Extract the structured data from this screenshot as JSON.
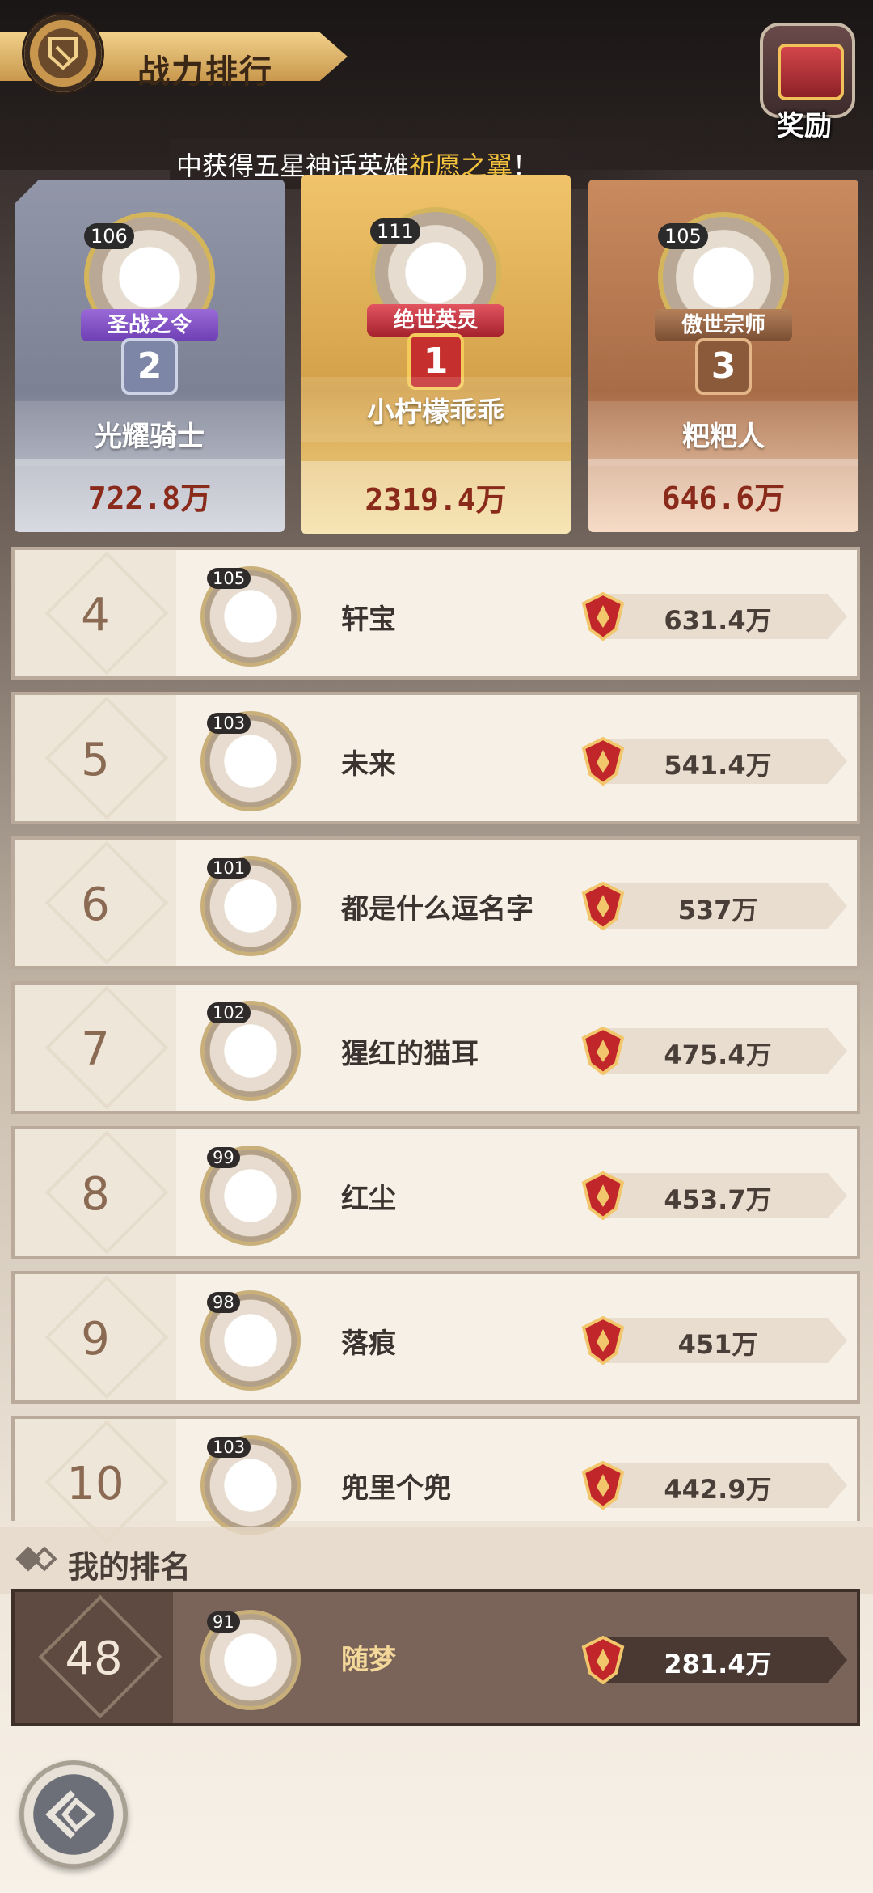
{
  "header": {
    "title": "战力排行",
    "reward_label": "奖励"
  },
  "marquee": {
    "prefix": "中获得五星神话英雄",
    "highlight": "祈愿之翼",
    "suffix": "！"
  },
  "podium": [
    {
      "rank": "2",
      "level": "106",
      "title": "圣战之令",
      "name": "光耀骑士",
      "power": "722.8万"
    },
    {
      "rank": "1",
      "level": "111",
      "title": "绝世英灵",
      "name": "小柠檬乖乖",
      "power": "2319.4万"
    },
    {
      "rank": "3",
      "level": "105",
      "title": "傲世宗师",
      "name": "粑粑人",
      "power": "646.6万"
    }
  ],
  "rows": [
    {
      "rank": "4",
      "level": "105",
      "name": "轩宝",
      "power": "631.4万"
    },
    {
      "rank": "5",
      "level": "103",
      "name": "未来",
      "power": "541.4万"
    },
    {
      "rank": "6",
      "level": "101",
      "name": "都是什么逗名字",
      "power": "537万"
    },
    {
      "rank": "7",
      "level": "102",
      "name": "猩红的猫耳",
      "power": "475.4万"
    },
    {
      "rank": "8",
      "level": "99",
      "name": "红尘",
      "power": "453.7万"
    },
    {
      "rank": "9",
      "level": "98",
      "name": "落痕",
      "power": "451万"
    },
    {
      "rank": "10",
      "level": "103",
      "name": "兜里个兜",
      "power": "442.9万"
    }
  ],
  "my_rank": {
    "label": "我的排名",
    "rank": "48",
    "level": "91",
    "name": "随梦",
    "power": "281.4万"
  },
  "colors": {
    "accent_gold": "#f3c33d",
    "power_red": "#c0262a"
  }
}
